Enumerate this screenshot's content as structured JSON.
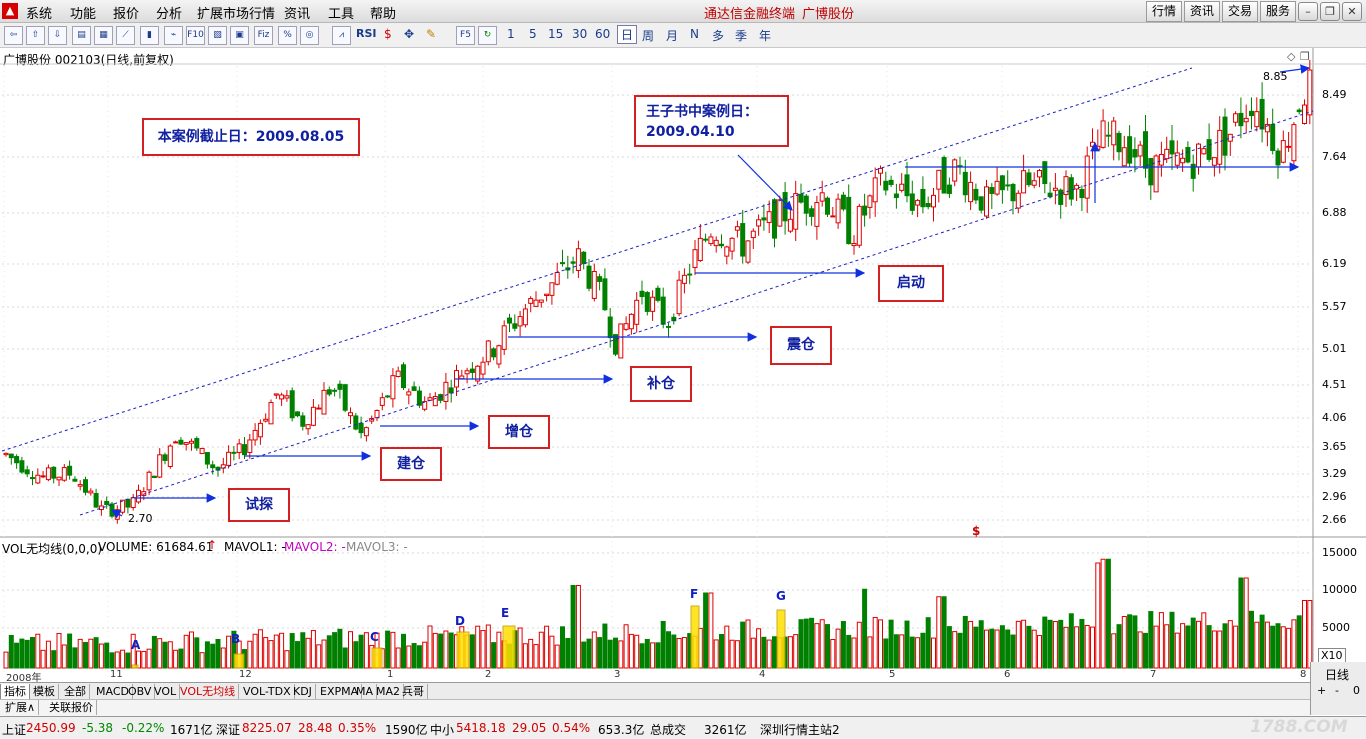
{
  "menubar": {
    "items": [
      "系统",
      "功能",
      "报价",
      "分析",
      "扩展市场行情",
      "资讯",
      "工具",
      "帮助"
    ],
    "app_title": "通达信金融终端",
    "stock_title": "广博股份",
    "buttons": [
      "行情",
      "资讯",
      "交易",
      "服务"
    ]
  },
  "toolbar": {
    "periods": [
      "1",
      "5",
      "15",
      "30",
      "60",
      "日",
      "周",
      "月",
      "N",
      "多",
      "季",
      "年"
    ],
    "icon_labels": [
      "RSI",
      "F5"
    ]
  },
  "chart_header": "广博股份 002103(日线,前复权)",
  "volume_header": {
    "name": "VOL无均线(0,0,0)",
    "volume": "VOLUME: 61684.61",
    "arrow": "↑",
    "mavol1": "MAVOL1: -",
    "mavol2": "MAVOL2: -",
    "mavol3": "MAVOL3: -"
  },
  "annotations": {
    "cutoff": "本案例截止日：2009.08.05",
    "case_day_line1": "王子书中案例日：",
    "case_day_line2": "2009.04.10",
    "labels": [
      "试探",
      "建仓",
      "增仓",
      "补仓",
      "震仓",
      "启动"
    ],
    "vol_markers": [
      "A",
      "B",
      "C",
      "D",
      "E",
      "F",
      "G"
    ],
    "low_label": "2.70",
    "high_label": "8.85",
    "dollar": "$"
  },
  "chart_data": {
    "type": "candlestick",
    "y_ticks": [
      "8.49",
      "7.64",
      "6.88",
      "6.19",
      "5.57",
      "5.01",
      "4.51",
      "4.06",
      "3.65",
      "3.29",
      "2.96",
      "2.66"
    ],
    "vol_ticks": [
      "15000",
      "10000",
      "5000"
    ],
    "vol_multiplier": "X10",
    "x_labels": [
      "2008年",
      "11",
      "12",
      "1",
      "2",
      "3",
      "4",
      "5",
      "6",
      "7",
      "8"
    ],
    "ylim": [
      2.6,
      9.0
    ],
    "vol_max": 16000,
    "last_volume": 61684.61
  },
  "bottom_tabs": {
    "items": [
      "指标",
      "模板",
      "全部",
      "MACD",
      "OBV",
      "VOL",
      "VOL无均线",
      "VOL-TDX",
      "KDJ",
      "EXPMA",
      "MA",
      "MA2",
      "兵哥"
    ],
    "row2": [
      "扩展∧",
      "关联报价"
    ],
    "right_label": "日线",
    "right_controls": [
      "+",
      "-",
      "0"
    ]
  },
  "status": {
    "sh_label": "上证",
    "sh_value": "2450.99",
    "sh_change": "-5.38",
    "sh_pct": "-0.22%",
    "sh_amount": "1671亿",
    "sz_label": "深证",
    "sz_value": "8225.07",
    "sz_change": "28.48",
    "sz_pct": "0.35%",
    "sz_amount": "1590亿",
    "zx_label": "中小",
    "zx_value": "5418.18",
    "zx_change": "29.05",
    "zx_pct": "0.54%",
    "zx_amount": "653.3亿",
    "total_label": "总成交",
    "total_amount": "3261亿",
    "server": "深圳行情主站2",
    "watermark": "1788.COM"
  },
  "colors": {
    "up": "#e00000",
    "down": "#008000",
    "channel": "#2020c0",
    "arrow": "#1030e0",
    "annotation_border": "#d42020"
  }
}
